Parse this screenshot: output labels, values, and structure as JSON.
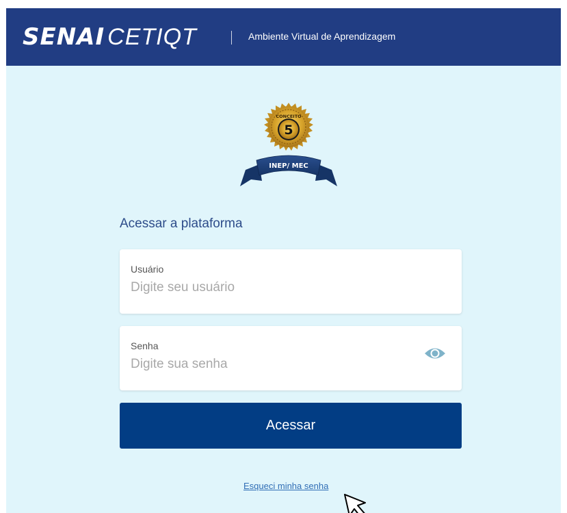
{
  "header": {
    "brand_bold": "SENAI",
    "brand_light": "CETIQT",
    "subtitle": "Ambiente Virtual de Aprendizagem"
  },
  "seal": {
    "top_text": "CONCEITO",
    "grade": "5",
    "ribbon_text": "INEP/ MEC"
  },
  "form": {
    "title": "Acessar a plataforma",
    "username": {
      "label": "Usuário",
      "placeholder": "Digite seu usuário",
      "value": ""
    },
    "password": {
      "label": "Senha",
      "placeholder": "Digite sua senha",
      "value": "",
      "toggle_icon": "eye-icon"
    },
    "submit_label": "Acessar",
    "forgot_link": "Esqueci minha senha"
  },
  "colors": {
    "header_bg": "#213d83",
    "page_bg": "#e0f5fb",
    "button_bg": "#023d84",
    "link": "#2f6db5",
    "title_text": "#2d4c8a"
  }
}
